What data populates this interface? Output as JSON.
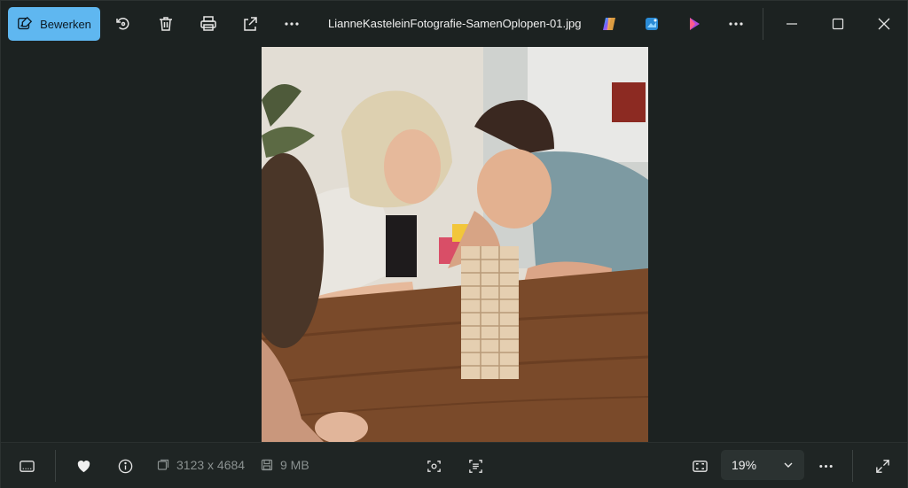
{
  "toolbar": {
    "edit_label": "Bewerken",
    "filename": "LianneKasteleinFotografie-SamenOplopen-01.jpg"
  },
  "footer": {
    "dimensions": "3123 x 4684",
    "file_size": "9 MB",
    "zoom": "19%"
  },
  "colors": {
    "accent": "#5fb7f0",
    "background": "#1c2221"
  }
}
